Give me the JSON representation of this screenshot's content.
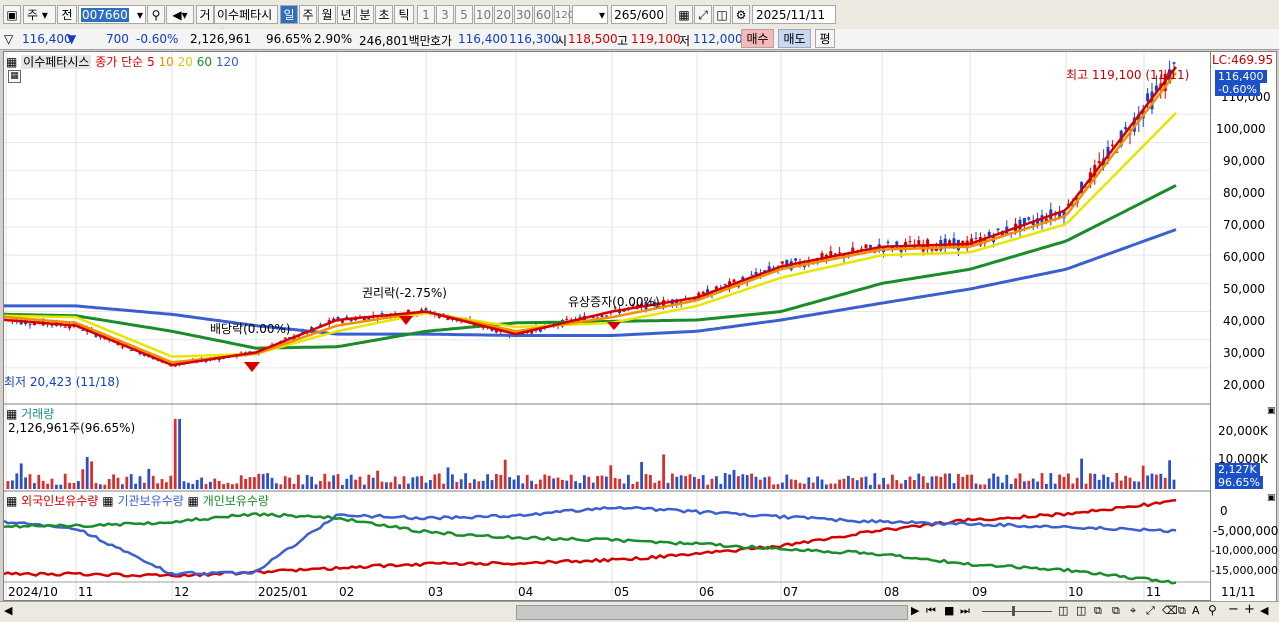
{
  "toolbar": {
    "market_label": "주",
    "prev_label": "전",
    "code": "007660",
    "type_label": "거",
    "stock_name": "이수페타시스",
    "periods": [
      "일",
      "주",
      "월",
      "년",
      "분",
      "초",
      "틱"
    ],
    "active_period": "일",
    "intervals": [
      "1",
      "3",
      "5",
      "10",
      "20",
      "30",
      "60",
      "120"
    ],
    "count": "265",
    "count_max": "/600",
    "date": "2025/11/11"
  },
  "quote": {
    "price": "116,400",
    "direction": "▼",
    "change": "700",
    "change_pct": "-0.60%",
    "volume": "2,126,961",
    "volume_ratio": "96.65%",
    "turnover_pct": "2.90%",
    "amount": "246,801백만",
    "ask_label": "호가",
    "ask": "116,400",
    "bid": "116,300",
    "open_label": "시",
    "open": "118,500",
    "high_label": "고",
    "high": "119,100",
    "low_label": "저",
    "low": "112,000",
    "buy_button": "매수",
    "sell_button": "매도",
    "eval_button": "평"
  },
  "legend": {
    "stock": "이수페타시스",
    "ma_prefix": "종가 단순",
    "ma_periods": [
      "5",
      "10",
      "20",
      "60",
      "120"
    ],
    "ma_colors": [
      "#d40000",
      "#f09000",
      "#e6e600",
      "#1a8c2a",
      "#3a5fd0"
    ]
  },
  "annotations": {
    "high_label": "최고 119,100 (11/11)",
    "low_label": "최저 20,423 (11/18)",
    "events": [
      "배당락(0.00%)",
      "권리락(-2.75%)",
      "유상증자(0.00%)"
    ]
  },
  "price_axis": {
    "lc_label": "LC:469.95",
    "ticks": [
      "110,000",
      "100,000",
      "90,000",
      "80,000",
      "70,000",
      "60,000",
      "50,000",
      "40,000",
      "30,000",
      "20,000"
    ],
    "current_price": "116,400",
    "current_change": "-0.60%"
  },
  "volume_panel": {
    "title": "거래량",
    "value": "2,126,961주(96.65%)",
    "ticks": [
      "20,000K",
      "10,000K"
    ],
    "current": "2,127K",
    "current_ratio": "96.65%"
  },
  "holding_panel": {
    "labels": [
      "외국인보유수량",
      "기관보유수량",
      "개인보유수량"
    ],
    "colors": [
      "#d40000",
      "#3a5fd0",
      "#1a8c2a"
    ],
    "ticks": [
      "0",
      "-5,000,000",
      "-10,000,000",
      "-15,000,000"
    ]
  },
  "x_axis": {
    "labels": [
      "2024/10",
      "11",
      "12",
      "2025/01",
      "02",
      "03",
      "04",
      "05",
      "06",
      "07",
      "08",
      "09",
      "10",
      "11"
    ],
    "right_label": "11/11"
  },
  "chart_data": {
    "type": "line",
    "title": "이수페타시스",
    "x": [
      "2024/10",
      "11",
      "12",
      "2025/01",
      "02",
      "03",
      "04",
      "05",
      "06",
      "07",
      "08",
      "09",
      "10",
      "11"
    ],
    "series": [
      {
        "name": "5",
        "values": [
          37000,
          35000,
          21000,
          25500,
          37000,
          40000,
          32000,
          40000,
          45000,
          56000,
          63000,
          64000,
          76000,
          112000
        ]
      },
      {
        "name": "10",
        "values": [
          38000,
          36000,
          22000,
          25000,
          35000,
          40000,
          33000,
          38000,
          44000,
          55000,
          62000,
          63000,
          74000,
          110000
        ]
      },
      {
        "name": "20",
        "values": [
          38500,
          38000,
          24000,
          25000,
          33000,
          39500,
          34500,
          36000,
          42000,
          52000,
          60000,
          61000,
          71000,
          99000
        ]
      },
      {
        "name": "60",
        "values": [
          39000,
          38500,
          33000,
          27000,
          27500,
          33000,
          36000,
          36500,
          37000,
          40000,
          50000,
          55000,
          65000,
          79000
        ]
      },
      {
        "name": "120",
        "values": [
          42000,
          42000,
          39000,
          35000,
          32000,
          32000,
          31500,
          31500,
          33000,
          37000,
          43000,
          48000,
          55000,
          65000
        ]
      }
    ],
    "ylim": [
      15000,
      125000
    ],
    "high": 119100,
    "low": 20423
  }
}
